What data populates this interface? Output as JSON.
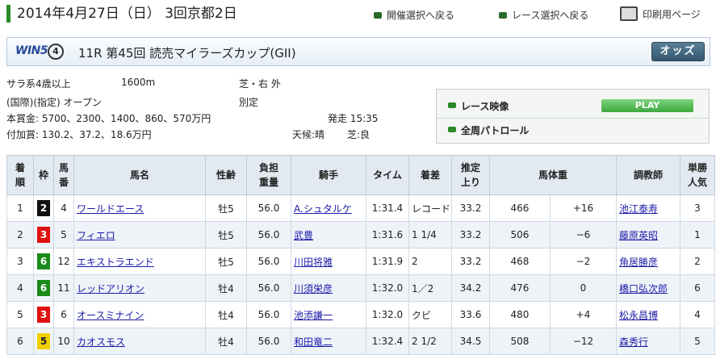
{
  "header": {
    "title": "2014年4月27日（日） 3回京都2日",
    "link_meeting": "開催選択へ戻る",
    "link_race": "レース選択へ戻る",
    "link_print": "印刷用ページ"
  },
  "race": {
    "win5_logo": "WIN5",
    "win5_num": "4",
    "title": "11R  第45回  読売マイラーズカップ(GII)",
    "odds_button": "オッズ",
    "cond1": "サラ系4歳以上",
    "distance": "1600m",
    "surface": "芝・右  外",
    "cond2": "(国際)(指定) オープン",
    "weight_rule": "別定",
    "prize": "本賞金:  5700、2300、1400、860、570万円",
    "start": "発走 15:35",
    "addprize": "付加賞:  130.2、37.2、18.6万円",
    "weather": "天候:晴",
    "track": "芝:良"
  },
  "video": {
    "label1": "レース映像",
    "play": "PLAY",
    "label2": "全周パトロール"
  },
  "table": {
    "headers": [
      "着\n順",
      "枠",
      "馬\n番",
      "馬名",
      "性齢",
      "負担\n重量",
      "騎手",
      "タイム",
      "着差",
      "推定\n上り",
      "馬体重",
      "",
      "調教師",
      "単勝\n人気"
    ],
    "rows": [
      {
        "rank": "1",
        "waku": "2",
        "waku_color": "#111111",
        "num": "4",
        "name": "ワールドエース",
        "sexage": "牡5",
        "weight": "56.0",
        "jockey": "A.シュタルケ",
        "time": "1:31.4",
        "margin": "レコード",
        "up": "33.2",
        "bw": "466",
        "diff": "+16",
        "trainer": "池江泰寿",
        "pop": "3"
      },
      {
        "rank": "2",
        "waku": "3",
        "waku_color": "#e01010",
        "num": "5",
        "name": "フィエロ",
        "sexage": "牡5",
        "weight": "56.0",
        "jockey": "武豊",
        "time": "1:31.6",
        "margin": "1 1/4",
        "up": "33.2",
        "bw": "506",
        "diff": "−6",
        "trainer": "藤原英昭",
        "pop": "1"
      },
      {
        "rank": "3",
        "waku": "6",
        "waku_color": "#1a8a1a",
        "num": "12",
        "name": "エキストラエンド",
        "sexage": "牡5",
        "weight": "56.0",
        "jockey": "川田将雅",
        "time": "1:31.9",
        "margin": "2",
        "up": "33.2",
        "bw": "468",
        "diff": "−2",
        "trainer": "角居勝彦",
        "pop": "2"
      },
      {
        "rank": "4",
        "waku": "6",
        "waku_color": "#1a8a1a",
        "num": "11",
        "name": "レッドアリオン",
        "sexage": "牡4",
        "weight": "56.0",
        "jockey": "川須栄彦",
        "time": "1:32.0",
        "margin": "1／2",
        "up": "34.2",
        "bw": "476",
        "diff": "0",
        "trainer": "橋口弘次郎",
        "pop": "6"
      },
      {
        "rank": "5",
        "waku": "3",
        "waku_color": "#e01010",
        "num": "6",
        "name": "オースミナイン",
        "sexage": "牡4",
        "weight": "56.0",
        "jockey": "池添謙一",
        "time": "1:32.0",
        "margin": "クビ",
        "up": "33.6",
        "bw": "480",
        "diff": "+4",
        "trainer": "松永昌博",
        "pop": "4"
      },
      {
        "rank": "6",
        "waku": "5",
        "waku_color": "#f0d000",
        "num": "10",
        "name": "カオスモス",
        "sexage": "牡4",
        "weight": "56.0",
        "jockey": "和田竜二",
        "time": "1:32.4",
        "margin": "2 1/2",
        "up": "34.5",
        "bw": "508",
        "diff": "−12",
        "trainer": "森秀行",
        "pop": "5"
      }
    ]
  }
}
